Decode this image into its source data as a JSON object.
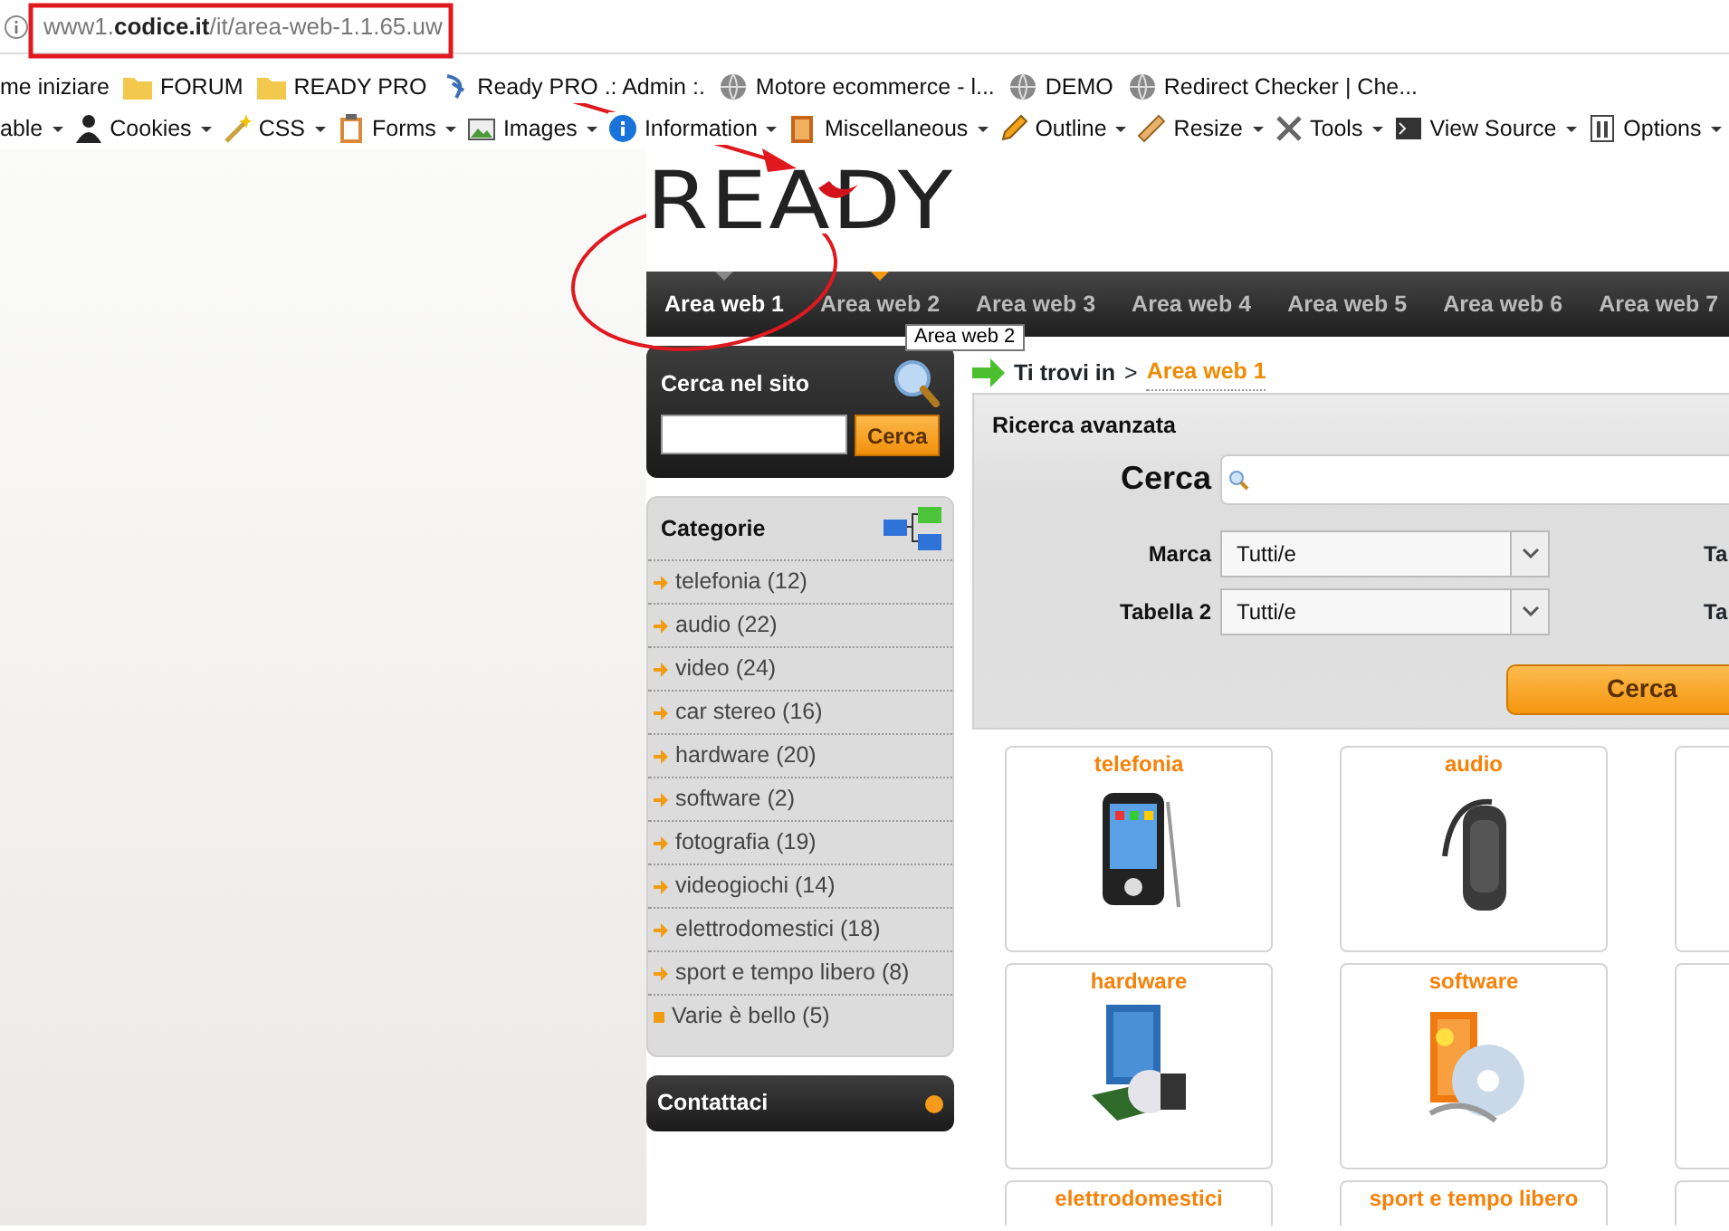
{
  "browser": {
    "url": "www1.**codice.it**/it/area-web-1.1.65.uw",
    "bookmarks": [
      {
        "label": "me iniziare",
        "kind": "plain"
      },
      {
        "label": "FORUM",
        "kind": "folder"
      },
      {
        "label": "READY PRO",
        "kind": "folder"
      },
      {
        "label": "Ready PRO .: Admin :.",
        "kind": "site"
      },
      {
        "label": "Motore ecommerce - l...",
        "kind": "globe"
      },
      {
        "label": "DEMO",
        "kind": "globe"
      },
      {
        "label": "Redirect Checker | Che...",
        "kind": "globe"
      }
    ],
    "toolbar": [
      {
        "label": "able"
      },
      {
        "label": "Cookies"
      },
      {
        "label": "CSS"
      },
      {
        "label": "Forms"
      },
      {
        "label": "Images"
      },
      {
        "label": "Information"
      },
      {
        "label": "Miscellaneous"
      },
      {
        "label": "Outline"
      },
      {
        "label": "Resize"
      },
      {
        "label": "Tools"
      },
      {
        "label": "View Source"
      },
      {
        "label": "Options"
      }
    ]
  },
  "site": {
    "logo": "READY",
    "nav": [
      {
        "label": "Area web 1",
        "selected": true,
        "hovered": false
      },
      {
        "label": "Area web 2",
        "selected": false,
        "hovered": true
      },
      {
        "label": "Area web 3",
        "selected": false,
        "hovered": false
      },
      {
        "label": "Area web 4",
        "selected": false,
        "hovered": false
      },
      {
        "label": "Area web 5",
        "selected": false,
        "hovered": false
      },
      {
        "label": "Area web 6",
        "selected": false,
        "hovered": false
      },
      {
        "label": "Area web 7",
        "selected": false,
        "hovered": false
      }
    ],
    "tooltip": "Area web 2",
    "site_search": {
      "title": "Cerca nel sito",
      "button": "Cerca"
    },
    "categories": {
      "title": "Categorie",
      "items": [
        {
          "label": "telefonia (12)",
          "kind": "arrow"
        },
        {
          "label": "audio (22)",
          "kind": "arrow"
        },
        {
          "label": "video (24)",
          "kind": "arrow"
        },
        {
          "label": "car stereo (16)",
          "kind": "arrow"
        },
        {
          "label": "hardware (20)",
          "kind": "arrow"
        },
        {
          "label": "software (2)",
          "kind": "arrow"
        },
        {
          "label": "fotografia (19)",
          "kind": "arrow"
        },
        {
          "label": "videogiochi (14)",
          "kind": "arrow"
        },
        {
          "label": "elettrodomestici (18)",
          "kind": "arrow"
        },
        {
          "label": "sport e tempo libero (8)",
          "kind": "arrow"
        },
        {
          "label": "Varie è bello (5)",
          "kind": "square"
        }
      ]
    },
    "contact": {
      "title": "Contattaci"
    },
    "breadcrumb": {
      "prefix": "Ti trovi in",
      "separator": ">",
      "current": "Area web 1"
    },
    "advanced_search": {
      "title": "Ricerca avanzata",
      "query_label": "Cerca",
      "fields": [
        {
          "label": "Marca",
          "value": "Tutti/e",
          "right_label": "Ta"
        },
        {
          "label": "Tabella 2",
          "value": "Tutti/e",
          "right_label": "Ta"
        }
      ],
      "button": "Cerca"
    },
    "tiles": [
      {
        "label": "telefonia",
        "kind": "picture"
      },
      {
        "label": "audio",
        "kind": "picture"
      },
      {
        "kind": "empty"
      },
      {
        "label": "hardware",
        "kind": "picture"
      },
      {
        "label": "software",
        "kind": "picture"
      },
      {
        "kind": "empty"
      },
      {
        "label": "elettrodomestici",
        "kind": "label"
      },
      {
        "label": "sport e tempo libero",
        "kind": "label"
      },
      {
        "kind": "empty"
      }
    ]
  }
}
